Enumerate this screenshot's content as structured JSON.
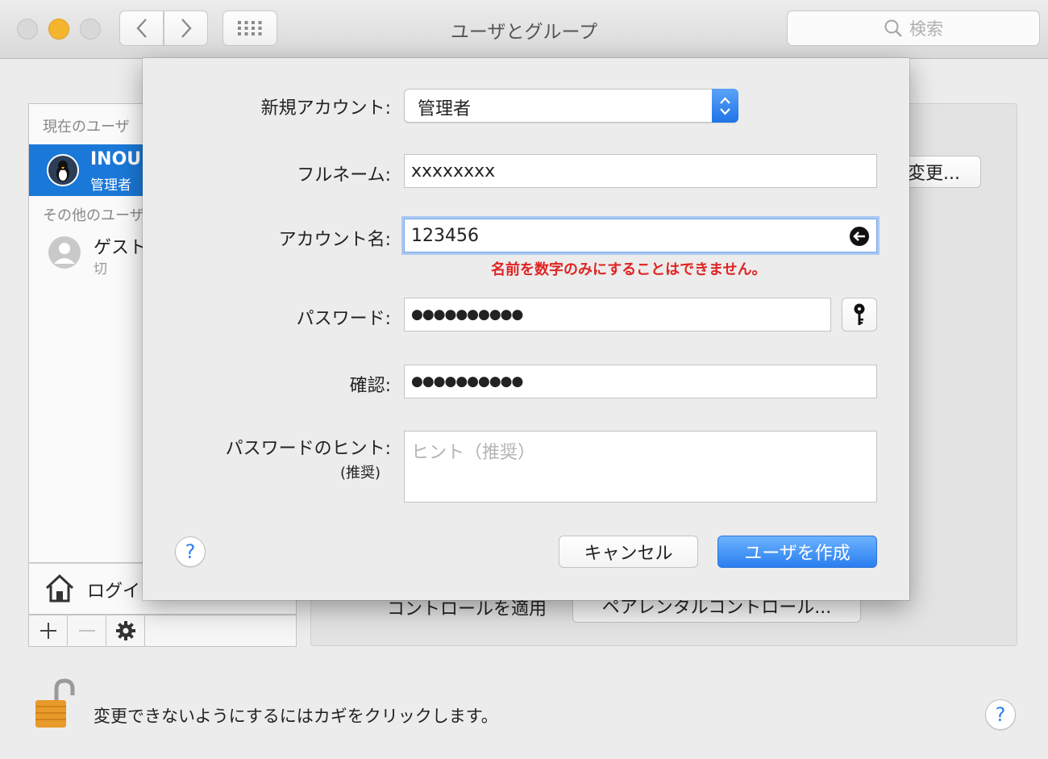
{
  "window": {
    "title": "ユーザとグループ",
    "search_placeholder": "検索"
  },
  "sidebar": {
    "current_users_header": "現在のユーザ",
    "current_user": {
      "name": "INOU",
      "role": "管理者"
    },
    "other_users_header": "その他のユーザ",
    "guest": {
      "name": "ゲスト",
      "status": "切"
    },
    "login_options": "ログイ"
  },
  "main": {
    "change_button": "変更...",
    "parental_label": "コントロールを適用",
    "parental_button": "ペアレンタルコントロール..."
  },
  "lock": {
    "message": "変更できないようにするにはカギをクリックします。"
  },
  "help": {
    "symbol": "?"
  },
  "sheet": {
    "new_account_label": "新規アカウント:",
    "new_account_value": "管理者",
    "fullname_label": "フルネーム:",
    "fullname_value": "xxxxxxxx",
    "account_label": "アカウント名:",
    "account_value": "123456",
    "error_message": "名前を数字のみにすることはできません。",
    "password_label": "パスワード:",
    "password_value": "●●●●●●●●●●",
    "verify_label": "確認:",
    "verify_value": "●●●●●●●●●●",
    "hint_label": "パスワードのヒント:",
    "hint_sublabel": "(推奨)",
    "hint_placeholder": "ヒント（推奨）",
    "cancel_button": "キャンセル",
    "create_button": "ユーザを作成"
  },
  "colors": {
    "accent": "#1a78d8",
    "error": "#e02424",
    "lock": "#e89a2a"
  }
}
